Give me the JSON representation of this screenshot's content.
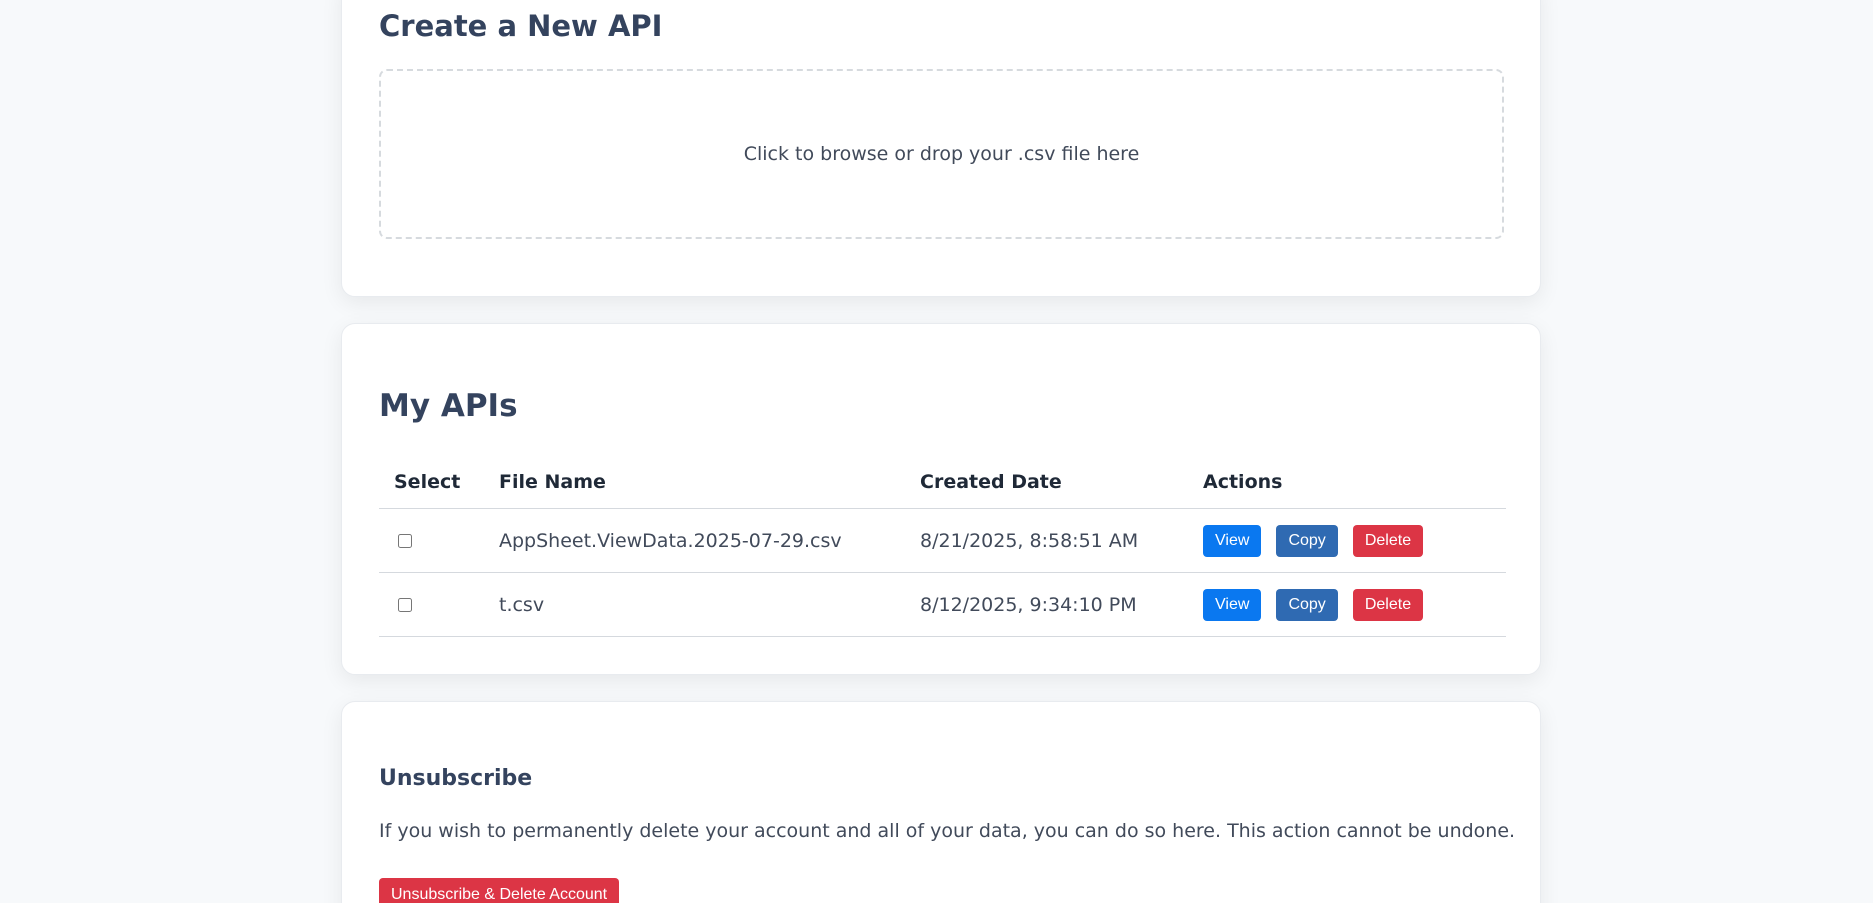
{
  "create_section": {
    "title": "Create a New API",
    "dropzone_text": "Click to browse or drop your .csv file here"
  },
  "apis_section": {
    "title": "My APIs",
    "columns": [
      "Select",
      "File Name",
      "Created Date",
      "Actions"
    ],
    "rows": [
      {
        "file_name": "AppSheet.ViewData.2025-07-29.csv",
        "created_date": "8/21/2025, 8:58:51 AM",
        "checked": false
      },
      {
        "file_name": "t.csv",
        "created_date": "8/12/2025, 9:34:10 PM",
        "checked": false
      }
    ],
    "actions": {
      "view": "View",
      "copy": "Copy",
      "delete": "Delete"
    }
  },
  "unsubscribe_section": {
    "title": "Unsubscribe",
    "description": "If you wish to permanently delete your account and all of your data, you can do so here. This action cannot be undone.",
    "button_label": "Unsubscribe & Delete Account"
  },
  "colors": {
    "background": "#f7f9fb",
    "heading": "#34435e",
    "view": "#0a78f0",
    "copy": "#2f6ab2",
    "delete": "#dc3545"
  }
}
